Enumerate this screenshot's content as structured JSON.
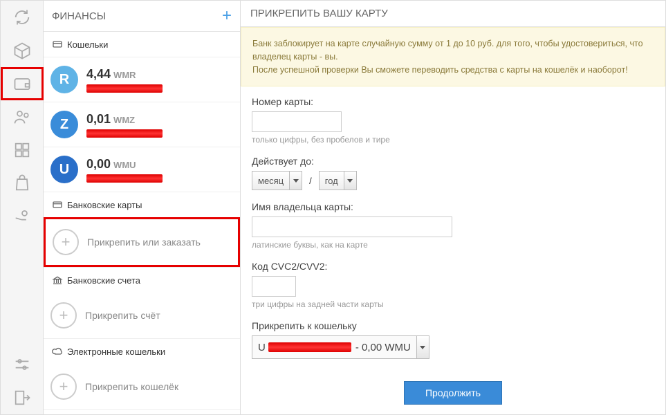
{
  "sidebar": {
    "title": "ФИНАНСЫ",
    "sections": {
      "wallets": "Кошельки",
      "cards": "Банковские карты",
      "bank_accounts": "Банковские счета",
      "ewallets": "Электронные кошельки"
    },
    "wallets_list": [
      {
        "letter": "R",
        "amount": "4,44",
        "currency": "WMR"
      },
      {
        "letter": "Z",
        "amount": "0,01",
        "currency": "WMZ"
      },
      {
        "letter": "U",
        "amount": "0,00",
        "currency": "WMU"
      }
    ],
    "actions": {
      "attach_card": "Прикрепить или заказать",
      "attach_account": "Прикрепить счёт",
      "attach_ewallet": "Прикрепить кошелёк"
    }
  },
  "main": {
    "title": "ПРИКРЕПИТЬ ВАШУ КАРТУ",
    "notice_l1": "Банк заблокирует на карте случайную сумму от 1 до 10 руб. для того, чтобы удостовериться, что владелец карты - вы.",
    "notice_l2": "После успешной проверки Вы сможете переводить средства с карты на кошелёк и наоборот!",
    "form": {
      "card_number_label": "Номер карты:",
      "card_number_hint": "только цифры, без пробелов и тире",
      "expires_label": "Действует до:",
      "month_placeholder": "месяц",
      "year_placeholder": "год",
      "holder_label": "Имя владельца карты:",
      "holder_hint": "латинские буквы, как на карте",
      "cvc_label": "Код CVC2/CVV2:",
      "cvc_hint": "три цифры на задней части карты",
      "attach_wallet_label": "Прикрепить к кошельку",
      "attach_wallet_prefix": "U",
      "attach_wallet_suffix": "- 0,00 WMU",
      "submit": "Продолжить"
    }
  }
}
